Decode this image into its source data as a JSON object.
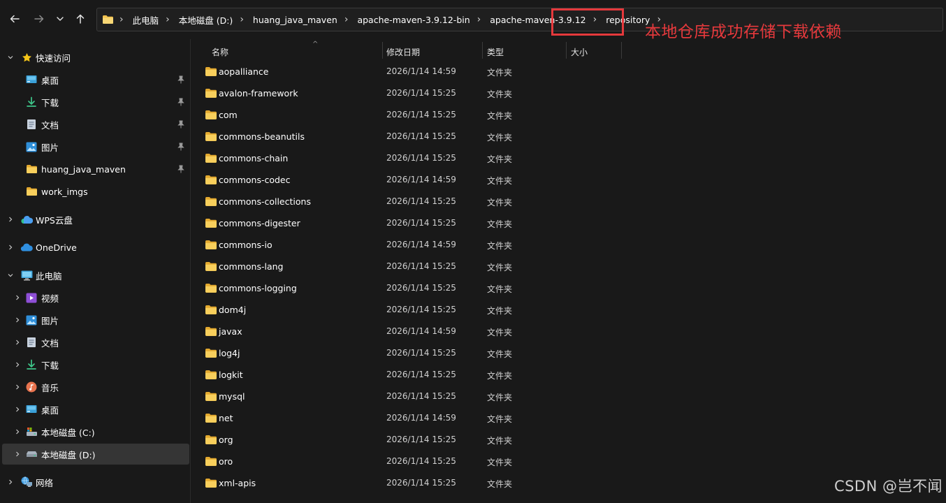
{
  "nav": {
    "back_icon": "arrow-left-icon",
    "forward_icon": "arrow-right-icon",
    "recent_icon": "chevron-down-icon",
    "up_icon": "arrow-up-icon"
  },
  "address": {
    "root_icon": "folder-icon",
    "crumbs": [
      "此电脑",
      "本地磁盘 (D:)",
      "huang_java_maven",
      "apache-maven-3.9.12-bin",
      "apache-maven-3.9.12",
      "repository"
    ]
  },
  "annotation": {
    "text": "本地仓库成功存储下载依赖",
    "color": "#e5393c"
  },
  "sidebar": {
    "quick_access": {
      "label": "快速访问",
      "icon": "star-icon"
    },
    "pinned": [
      {
        "label": "桌面",
        "icon": "desktop-icon",
        "pinned": true
      },
      {
        "label": "下载",
        "icon": "download-icon",
        "pinned": true
      },
      {
        "label": "文档",
        "icon": "document-icon",
        "pinned": true
      },
      {
        "label": "图片",
        "icon": "picture-icon",
        "pinned": true
      },
      {
        "label": "huang_java_maven",
        "icon": "folder-icon",
        "pinned": true
      },
      {
        "label": "work_imgs",
        "icon": "folder-icon",
        "pinned": false
      }
    ],
    "wps": {
      "label": "WPS云盘",
      "icon": "cloud-icon"
    },
    "onedrive": {
      "label": "OneDrive",
      "icon": "onedrive-icon"
    },
    "this_pc": {
      "label": "此电脑",
      "icon": "computer-icon"
    },
    "pc_items": [
      {
        "label": "视频",
        "icon": "video-icon"
      },
      {
        "label": "图片",
        "icon": "picture-icon"
      },
      {
        "label": "文档",
        "icon": "document-icon"
      },
      {
        "label": "下载",
        "icon": "download-icon"
      },
      {
        "label": "音乐",
        "icon": "music-icon"
      },
      {
        "label": "桌面",
        "icon": "desktop-icon"
      },
      {
        "label": "本地磁盘 (C:)",
        "icon": "drive-c-icon"
      },
      {
        "label": "本地磁盘 (D:)",
        "icon": "drive-icon",
        "selected": true
      }
    ],
    "network": {
      "label": "网络",
      "icon": "network-icon"
    }
  },
  "columns": {
    "name": "名称",
    "modified": "修改日期",
    "type": "类型",
    "size": "大小"
  },
  "files": [
    {
      "name": "aopalliance",
      "modified": "2026/1/14 14:59",
      "type": "文件夹"
    },
    {
      "name": "avalon-framework",
      "modified": "2026/1/14 15:25",
      "type": "文件夹"
    },
    {
      "name": "com",
      "modified": "2026/1/14 15:25",
      "type": "文件夹"
    },
    {
      "name": "commons-beanutils",
      "modified": "2026/1/14 15:25",
      "type": "文件夹"
    },
    {
      "name": "commons-chain",
      "modified": "2026/1/14 15:25",
      "type": "文件夹"
    },
    {
      "name": "commons-codec",
      "modified": "2026/1/14 14:59",
      "type": "文件夹"
    },
    {
      "name": "commons-collections",
      "modified": "2026/1/14 15:25",
      "type": "文件夹"
    },
    {
      "name": "commons-digester",
      "modified": "2026/1/14 15:25",
      "type": "文件夹"
    },
    {
      "name": "commons-io",
      "modified": "2026/1/14 14:59",
      "type": "文件夹"
    },
    {
      "name": "commons-lang",
      "modified": "2026/1/14 15:25",
      "type": "文件夹"
    },
    {
      "name": "commons-logging",
      "modified": "2026/1/14 15:25",
      "type": "文件夹"
    },
    {
      "name": "dom4j",
      "modified": "2026/1/14 15:25",
      "type": "文件夹"
    },
    {
      "name": "javax",
      "modified": "2026/1/14 14:59",
      "type": "文件夹"
    },
    {
      "name": "log4j",
      "modified": "2026/1/14 15:25",
      "type": "文件夹"
    },
    {
      "name": "logkit",
      "modified": "2026/1/14 15:25",
      "type": "文件夹"
    },
    {
      "name": "mysql",
      "modified": "2026/1/14 15:25",
      "type": "文件夹"
    },
    {
      "name": "net",
      "modified": "2026/1/14 14:59",
      "type": "文件夹"
    },
    {
      "name": "org",
      "modified": "2026/1/14 15:25",
      "type": "文件夹"
    },
    {
      "name": "oro",
      "modified": "2026/1/14 15:25",
      "type": "文件夹"
    },
    {
      "name": "xml-apis",
      "modified": "2026/1/14 15:25",
      "type": "文件夹"
    }
  ],
  "watermark": "CSDN @岂不闻"
}
